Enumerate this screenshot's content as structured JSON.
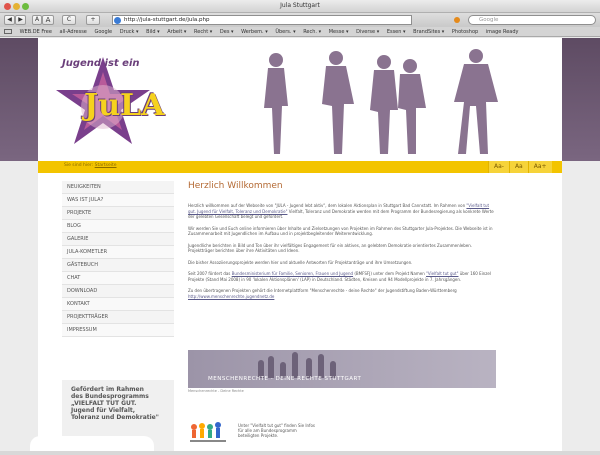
{
  "window": {
    "title": "Jula Stuttgart"
  },
  "navbar": {
    "url": "http://jula-stuttgart.de/jula.php",
    "search_placeholder": "Google",
    "back_label": "◀",
    "forward_label": "▶",
    "font_small": "A",
    "font_large": "A",
    "reload_label": "C",
    "add_label": "+"
  },
  "bookmarks": [
    "WEB.DE Free",
    "all-Adresse",
    "Google",
    "Druck ▾",
    "Bild ▾",
    "Arbeit ▾",
    "Recht ▾",
    "Des ▾",
    "Werbem. ▾",
    "Übers. ▾",
    "Rech. ▾",
    "Messe ▾",
    "Diverse ▾",
    "Essen ▾",
    "BrandSites ▾",
    "Photoshop",
    "image Ready"
  ],
  "header": {
    "logo_top": "Jugend ist ein",
    "logo_main": "JuLA"
  },
  "breadcrumb": {
    "prefix": "Sie sind hier:",
    "link": "Startseite"
  },
  "font_sizes": [
    "Aa-",
    "Aa",
    "Aa+"
  ],
  "nav": [
    "Neuigkeiten",
    "Was ist Jula?",
    "Projekte",
    "Blog",
    "Galerie",
    "Jula-Kometler",
    "Gästebuch",
    "Chat",
    "Download",
    "Kontakt",
    "Projektträger",
    "Impressum"
  ],
  "promo": {
    "text": "Gefördert im Rahmen\ndes Bundesprogramms\n„VIELFALT TUT GUT.\nJugend für Vielfalt,\nToleranz und Demokratie\""
  },
  "content": {
    "heading": "Herzlich Willkommen",
    "p1": "Herzlich willkommen auf der Webseite von \"JULA - Jugend lebt aktiv\", dem lokalen Aktionsplan in Stuttgart Bad Cannstatt. Im Rahmen von",
    "p1_link": "\"Vielfalt tut gut. Jugend für Vielfalt, Toleranz und Demokratie\"",
    "p1_end": "Vielfalt, Toleranz und Demokratie werden mit dem Programm der Bundesregierung als konkrete Werte der gelebten Gesellschaft belegt und gefördert.",
    "p2": "Wir werden Sie und Euch online informieren über Inhalte und Zielsetzungen von Projekten im Rahmen des Stuttgarter Jula-Projektes. Die Webseite ist in Zusammenarbeit mit Jugendlichen im Aufbau und in projektbegleitender Weiterentwicklung.",
    "p3": "Jugendliche berichten in Bild und Ton über ihr vielfältiges Engagement für ein aktives, an gelebtem Demokratie orientiertes Zusammenleben. Projektträger berichten über ihre Aktivitäten und Ideen.",
    "p4": "Die bisher Assoziierungsprojekte werden hier und aktuelle Antworten für Projektanträge und ihre Umsetzungen.",
    "p5": "Seit 2007 fördert das",
    "p5_link": "Bundesministerium für Familie, Senioren, Frauen und Jugend",
    "p5_mid": "(BMFSFJ) unter dem Projekt Namen",
    "p5_link2": "\"Vielfalt tut gut\"",
    "p5_end": "über 160 Einzel Projekte (Stand Mai 2008) in 90 'lokalen Aktionsplänen' (LAP) in Deutschland. Städten, Kreisen und 94 Modellprojekte in 7. Jahrsgängen.",
    "p6": "Zu den übertragenen Projekten gehört die Internetplattform \"Menschenrechte - deine Rechte\" der Jugendstiftung Baden-Württemberg",
    "p6_link": "http://www.menschenrechte.jugendnetz.de",
    "banner_text": "MENSCHENRECHTE - DEINE RECHTE STUTTGART",
    "banner_caption": "Menschenrechte - Deine Rechte",
    "vielfalt_text": "Unter \"Vielfalt tut gut\" finden Sie Infos für alle am Bundesprogramm beteiligten Projekte."
  },
  "colors": {
    "accent_yellow": "#f3c400",
    "purple": "#8c7592",
    "heading": "#b46a34"
  }
}
